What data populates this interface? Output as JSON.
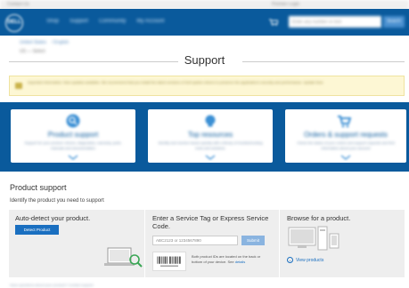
{
  "utility_bar": {
    "left_text": "Contact Us",
    "right_text": "Premier Login"
  },
  "masthead": {
    "logo_text": "DELL",
    "nav": [
      "Shop",
      "Support",
      "Community",
      "My Account"
    ],
    "search_placeholder": "Enter any number or text",
    "search_button": "Search",
    "brand_color": "#0a5a9c"
  },
  "breadcrumb": {
    "items": [
      "United States",
      "/ English"
    ],
    "sub": "US — Select"
  },
  "page_title": "Support",
  "alert": {
    "text": "Important Information: New updates available. We recommend that you install the latest versions of Dell system drivers to preserve the application's security and performance.  Update Now",
    "color": "#fdf7d4"
  },
  "cards": [
    {
      "title": "Product support",
      "desc": "Support for your product: drivers, diagnostics, warranty, parts, manuals and documentation",
      "icon": "magnifier-icon"
    },
    {
      "title": "Top resources",
      "desc": "Identify and resolve issues quickly with a library of troubleshooting tools and solutions",
      "icon": "lightbulb-icon"
    },
    {
      "title": "Orders & support requests",
      "desc": "Check the status of your orders and support requests and find information about your account",
      "icon": "cart-icon"
    }
  ],
  "product_support": {
    "title": "Product support",
    "subtitle": "Identify the product you need to support",
    "auto_detect": {
      "title": "Auto-detect your product.",
      "button": "Detect Product"
    },
    "service_tag": {
      "title": "Enter a Service Tag or Express Service Code.",
      "placeholder": "ABC2123 or 1234567890",
      "submit": "Submit",
      "help_text": "Both product IDs are located on the back or bottom of your device. See",
      "help_link": "details"
    },
    "browse": {
      "title": "Browse for a product.",
      "link": "View products"
    }
  },
  "footer_note": "Have questions about your product? Contact support"
}
